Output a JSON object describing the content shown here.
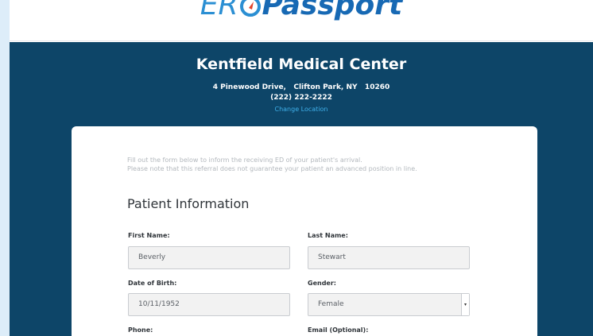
{
  "brand": {
    "logo_er": "ER",
    "logo_passport": "Passport"
  },
  "facility": {
    "name": "Kentfield Medical Center",
    "address": "4 Pinewood Drive,   Clifton Park, NY   10260",
    "phone": "(222) 222-2222",
    "change_location_label": "Change Location"
  },
  "form": {
    "intro_line1": "Fill out the form below to inform the receiving ED of your patient's arrival.",
    "intro_line2": "Please note that this referral does not guarantee your patient an advanced position in line.",
    "section_title": "Patient Information",
    "first_name": {
      "label": "First Name:",
      "value": "Beverly"
    },
    "last_name": {
      "label": "Last Name:",
      "value": "Stewart"
    },
    "dob": {
      "label": "Date of Birth:",
      "value": "10/11/1952"
    },
    "gender": {
      "label": "Gender:",
      "value": "Female"
    },
    "phone": {
      "label": "Phone:"
    },
    "email": {
      "label": "Email (Optional):"
    }
  },
  "colors": {
    "band": "#0d4568",
    "page_bg": "#ddedf9",
    "logo_light": "#2b8fd3",
    "logo_dark": "#1769b4",
    "link": "#3fb0ea"
  }
}
